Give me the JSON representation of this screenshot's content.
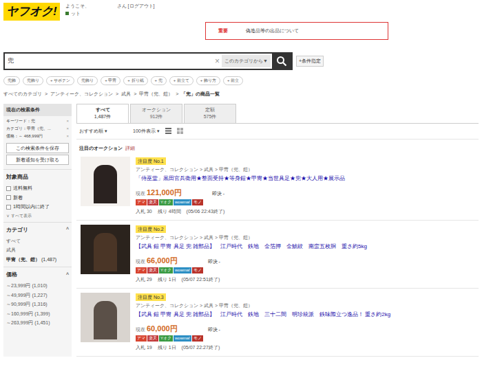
{
  "header": {
    "logo": "ヤフオク!",
    "welcome": "ようこそ、",
    "user_suffix": "さん [ログアウト]",
    "point": "ット"
  },
  "notice": {
    "label": "重要",
    "text": "偽造品等の出品について"
  },
  "search": {
    "query": "兜",
    "clear": "×",
    "category": "このカテゴリから▼",
    "options": "+条件指定"
  },
  "suggestions": [
    "兜飾",
    "兜飾り",
    "+ サボテン",
    "兜飾り",
    "+ 甲冑",
    "+ 折り紙",
    "+ 兜",
    "+ 前立て",
    "+ 飾り方",
    "+ 前立"
  ],
  "breadcrumb": [
    "すべてのカテゴリ",
    "アンティーク、コレクション",
    "武具",
    "甲冑（兜、鎧）",
    "「兜」の商品一覧"
  ],
  "breadcrumb_sep": ">",
  "sidebar": {
    "conditions_title": "現在の検索条件",
    "conditions": [
      {
        "text": "キーワード：兜",
        "remove": "×"
      },
      {
        "text": "カテゴリ：甲冑（兜、...",
        "remove": "×"
      },
      {
        "text": "価格：～ 468,999円",
        "remove": "×"
      }
    ],
    "save_button": "この検索条件を保存",
    "notify_button": "新着通知を受け取る",
    "target": {
      "title": "対象商品",
      "items": [
        {
          "label": "送料無料",
          "checked": false
        },
        {
          "label": "新着",
          "checked": false
        },
        {
          "label": "1時間以内に終了",
          "checked": false
        }
      ],
      "show_all": "∨ すべて表示"
    },
    "category": {
      "title": "カテゴリ",
      "toggle": "^",
      "items": [
        {
          "label": "すべて",
          "count": "",
          "selected": false
        },
        {
          "label": "武具",
          "count": "",
          "selected": false
        },
        {
          "label": "甲冑（兜、鎧）",
          "count": "(1,487)",
          "selected": true
        }
      ]
    },
    "price": {
      "title": "価格",
      "toggle": "^",
      "items": [
        {
          "label": "～23,999円",
          "count": "(1,010)"
        },
        {
          "label": "～49,999円",
          "count": "(1,227)"
        },
        {
          "label": "～90,999円",
          "count": "(1,316)"
        },
        {
          "label": "～160,999円",
          "count": "(1,399)"
        },
        {
          "label": "～263,999円",
          "count": "(1,451)"
        }
      ]
    }
  },
  "tabs": [
    {
      "label": "すべて",
      "count": "1,487件",
      "selected": true
    },
    {
      "label": "オークション",
      "count": "912件",
      "selected": false
    },
    {
      "label": "定額",
      "count": "575件",
      "selected": false
    }
  ],
  "sort": {
    "order": "おすすめ順",
    "per_page": "100件表示",
    "arrow": "▾"
  },
  "featured": {
    "title": "注目のオークション",
    "detail": "詳細"
  },
  "items": [
    {
      "badge": "注目度 No.1",
      "category": "アンティーク、コレクション > 武具 > 甲冑（兜、鎧）",
      "title": "「侍巫堂」黒田官兵衛用★整面受持★等身鎧★甲冑★当世具足★兜★大人用★展示品",
      "price_label": "現在",
      "price": "121,000円",
      "buyout": "即決 -",
      "bids": "入札 30",
      "remaining": "残り 4時間",
      "end": "(05/06 22:43終了)",
      "photo": "#2a2220",
      "photo_bg": "#f4f1ee"
    },
    {
      "badge": "注目度 No.2",
      "category": "アンティーク、コレクション > 武具 > 甲冑（兜、鎧）",
      "title": "【武具 鎧 甲冑 具足 兜 雑部品】　江戸時代　鉄地　金箔押　金鯱紋　南蛮五枚胴　重さ約5kg",
      "price_label": "現在",
      "price": "66,000円",
      "buyout": "即決 -",
      "bids": "入札 29",
      "remaining": "残り 1日",
      "end": "(05/07 22:51終了)",
      "photo": "#4a3526",
      "photo_bg": "#2b231d"
    },
    {
      "badge": "注目度 No.3",
      "category": "アンティーク、コレクション > 武具 > 甲冑（兜、鎧）",
      "title": "【武具 鎧 甲冑 具足 兜 雑部品】　江戸時代　鉄地　三十二間　明珍統派　鉄味際立つ逸品！ 重さ約2kg",
      "price_label": "現在",
      "price": "60,000円",
      "buyout": "即決 -",
      "bids": "入札 19",
      "remaining": "残り 1日",
      "end": "(05/07 22:27終了)",
      "photo": "#5b5048",
      "photo_bg": "#d9d4cf"
    }
  ],
  "shop_tags": [
    {
      "label": "アマ",
      "color": "#d8442f"
    },
    {
      "label": "楽天",
      "color": "#c23b3b"
    },
    {
      "label": "Yオク",
      "color": "#3a9b44"
    },
    {
      "label": "wowma!",
      "color": "#2d8fc4"
    },
    {
      "label": "モノ",
      "color": "#b8322a"
    }
  ]
}
